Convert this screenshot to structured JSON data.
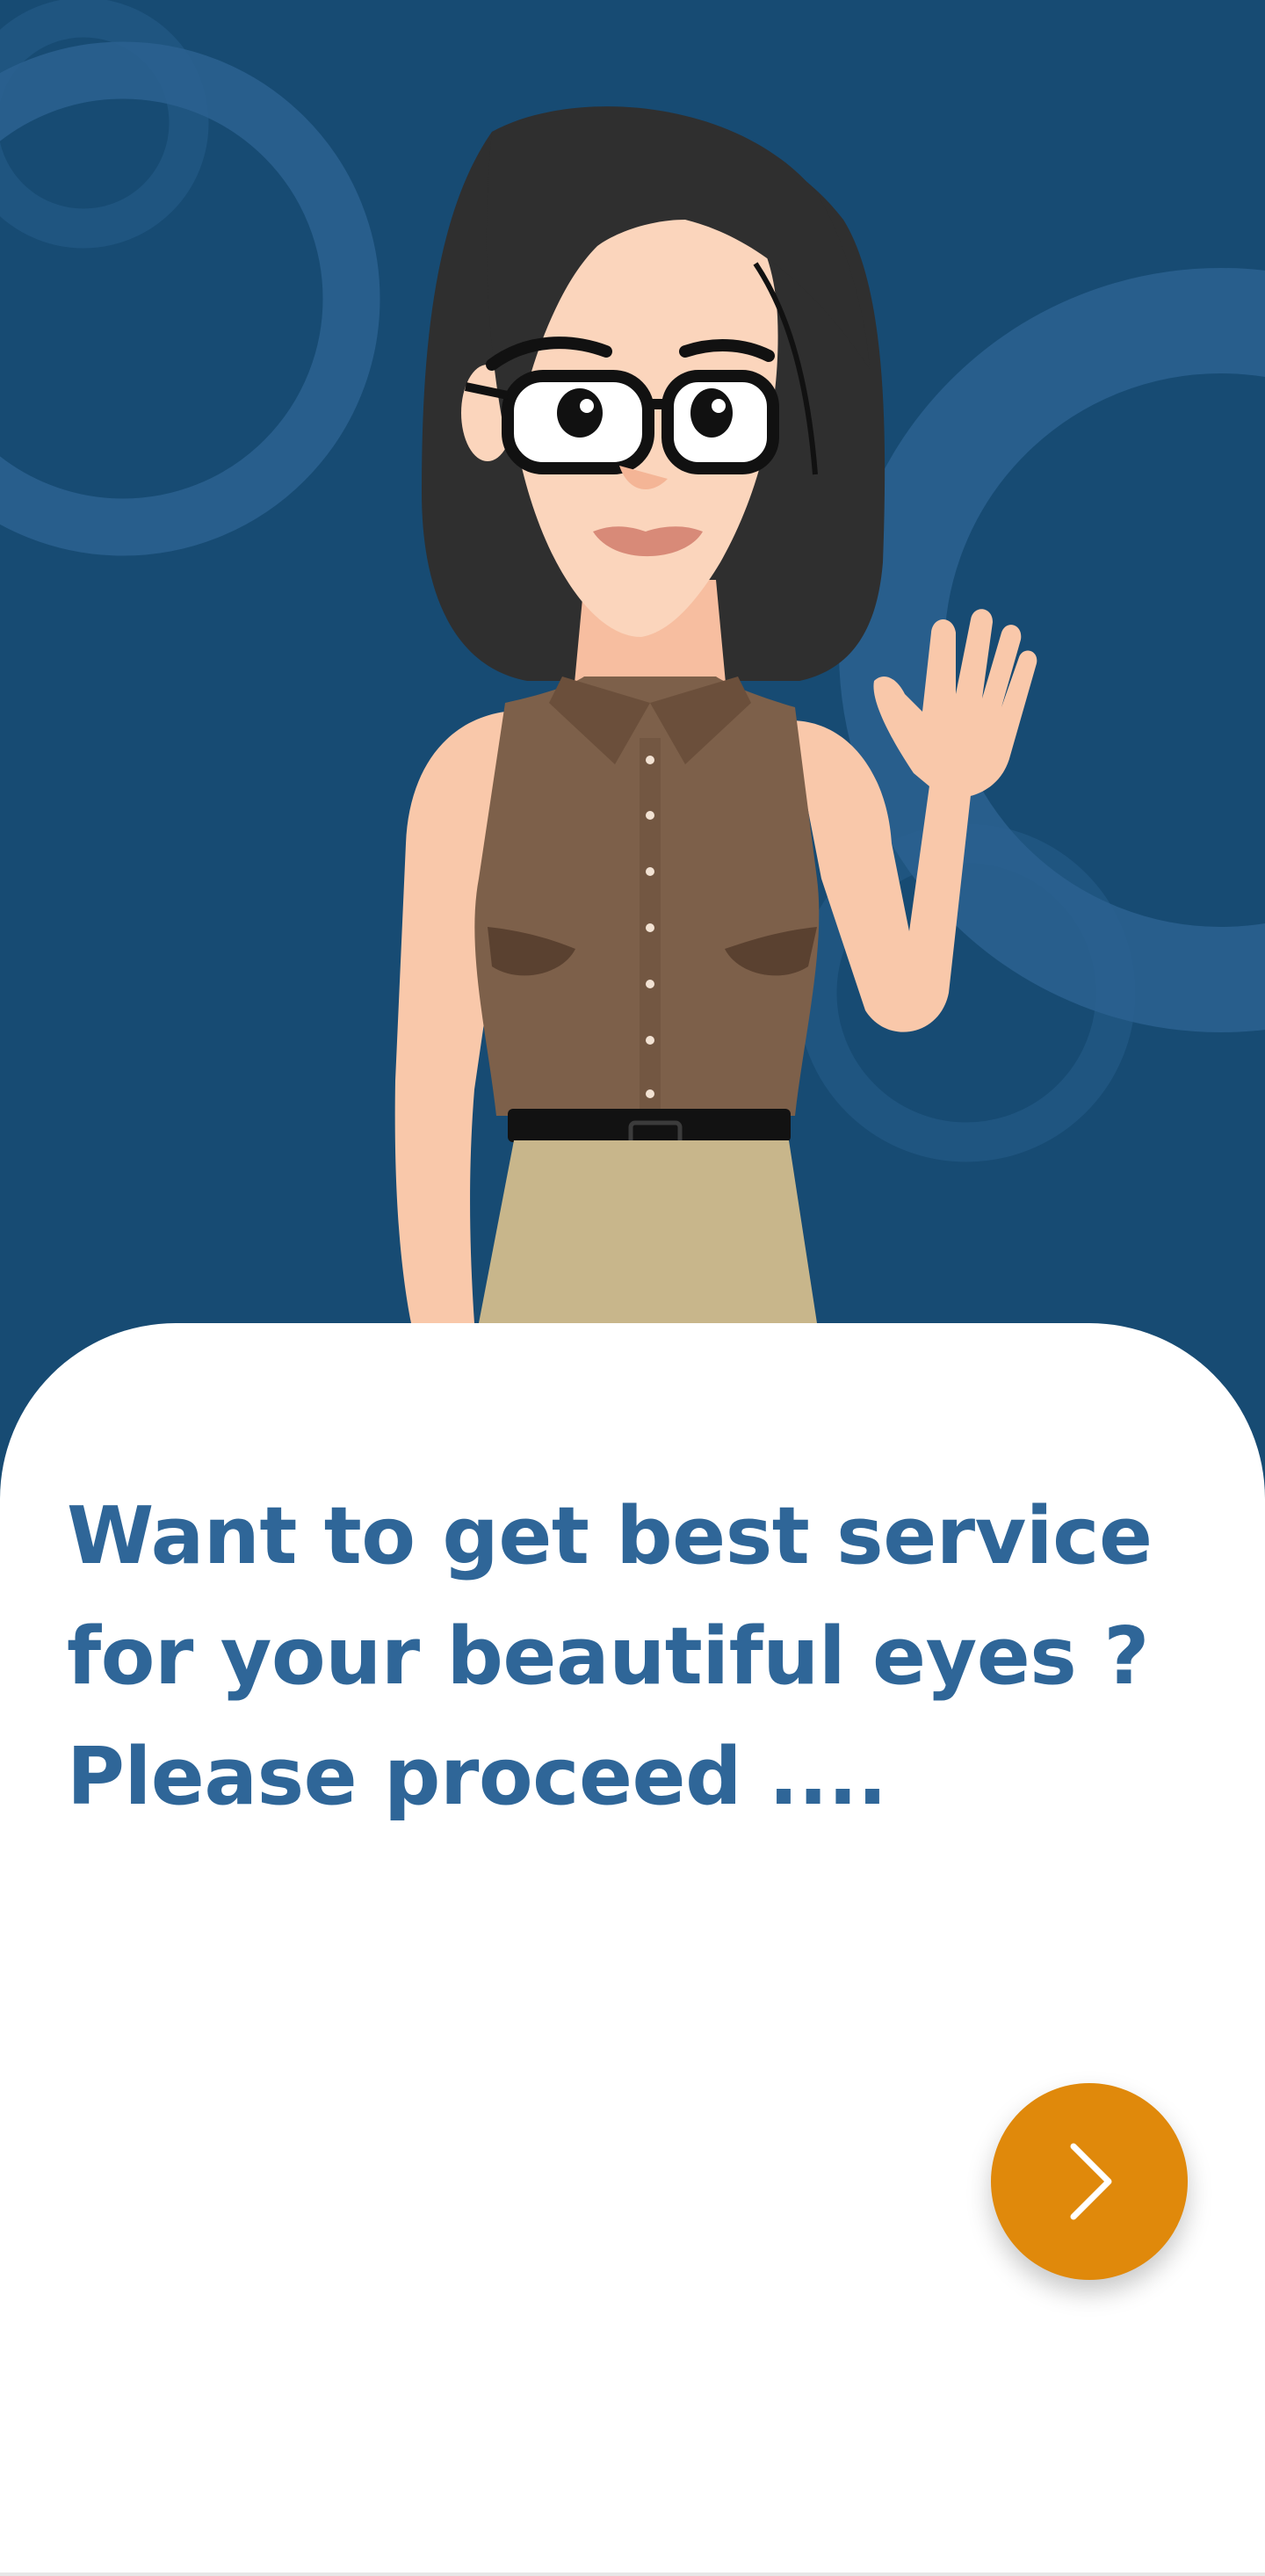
{
  "colors": {
    "background": "#174b73",
    "accent": "#e0890b",
    "headline": "#2f6698"
  },
  "illustration": {
    "subject": "waving-woman-with-glasses"
  },
  "onboarding": {
    "headline_lines": [
      "Want to get best service",
      "for your beautiful eyes ?",
      "Please proceed ...."
    ]
  },
  "next_button": {
    "icon": "chevron-right-icon"
  }
}
